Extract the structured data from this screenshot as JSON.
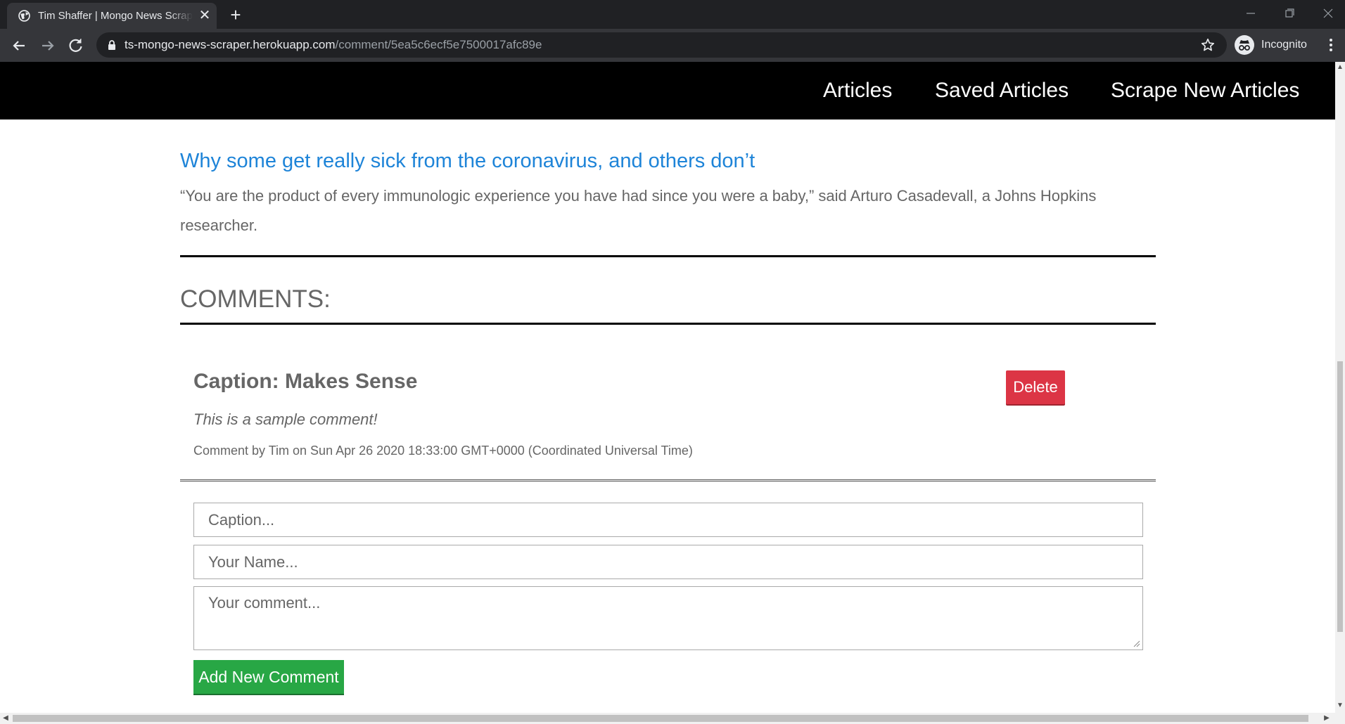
{
  "browser": {
    "tab_title": "Tim Shaffer | Mongo News Scraper",
    "tab_close": "✕",
    "new_tab": "+",
    "url_host": "ts-mongo-news-scraper.herokuapp.com",
    "url_path": "/comment/5ea5c6ecf5e7500017afc89e",
    "profile_label": "Incognito"
  },
  "nav": {
    "links": [
      "Articles",
      "Saved Articles",
      "Scrape New Articles"
    ]
  },
  "article": {
    "title": "Why some get really sick from the coronavirus, and others don’t",
    "summary": "“You are the product of every immunologic experience you have had since you were a baby,” said Arturo Casadevall, a Johns Hopkins researcher."
  },
  "comments": {
    "heading": "COMMENTS:",
    "items": [
      {
        "caption": "Caption: Makes Sense",
        "body": "This is a sample comment!",
        "meta": "Comment by Tim on Sun Apr 26 2020 18:33:00 GMT+0000 (Coordinated Universal Time)",
        "delete_label": "Delete"
      }
    ]
  },
  "form": {
    "caption_placeholder": "Caption...",
    "name_placeholder": "Your Name...",
    "comment_placeholder": "Your comment...",
    "submit_label": "Add New Comment"
  },
  "colors": {
    "nav_bg": "#000000",
    "link": "#1e84d8",
    "delete": "#dc3545",
    "submit": "#28a745"
  }
}
